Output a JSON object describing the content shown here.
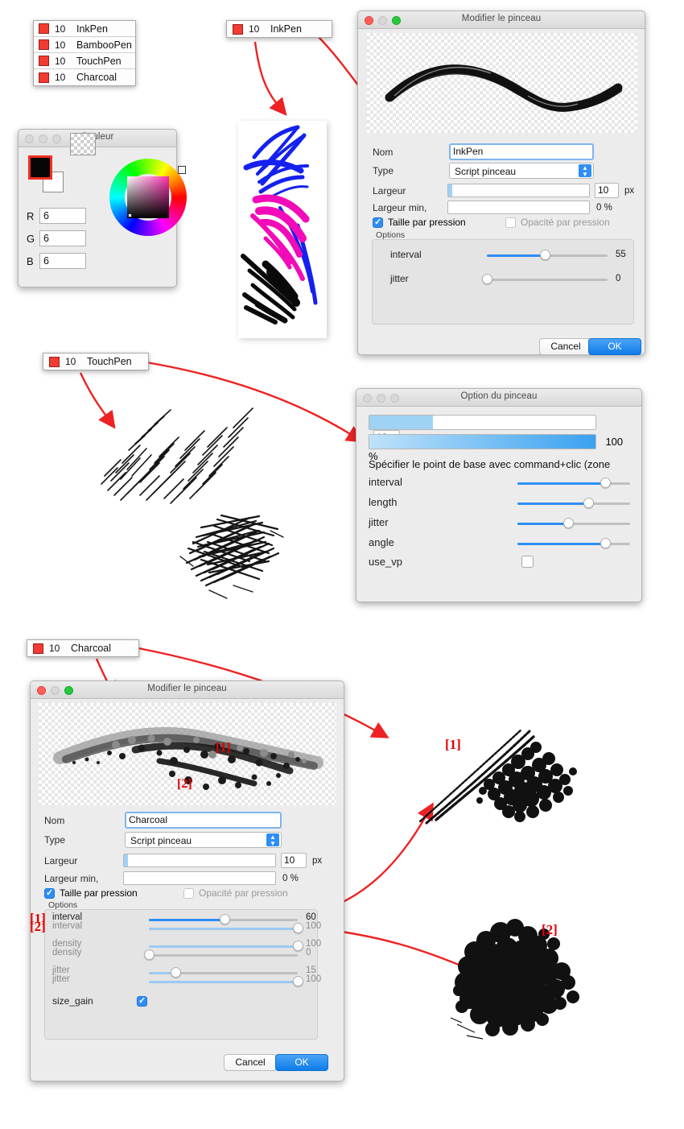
{
  "brush_palette": {
    "items": [
      {
        "size": "10",
        "name": "InkPen"
      },
      {
        "size": "10",
        "name": "BambooPen"
      },
      {
        "size": "10",
        "name": "TouchPen"
      },
      {
        "size": "10",
        "name": "Charcoal"
      }
    ],
    "swatch_color": "#f23b33"
  },
  "tags": {
    "inkpen": {
      "size": "10",
      "name": "InkPen"
    },
    "touchpen": {
      "size": "10",
      "name": "TouchPen"
    },
    "charcoal": {
      "size": "10",
      "name": "Charcoal"
    }
  },
  "color_window": {
    "title": "Couleur",
    "channels": [
      {
        "label": "R",
        "value": "6"
      },
      {
        "label": "G",
        "value": "6"
      },
      {
        "label": "B",
        "value": "6"
      }
    ],
    "foreground_color": "#060606",
    "background_color": "#ffffff"
  },
  "inkpen_dialog": {
    "title": "Modifier le pinceau",
    "fields": {
      "nom_label": "Nom",
      "nom_value": "InkPen",
      "type_label": "Type",
      "type_value": "Script pinceau",
      "largeur_label": "Largeur",
      "largeur_value": "10",
      "largeur_unit": "px",
      "largeur_min_label": "Largeur min,",
      "largeur_min_value": "0 %",
      "taille_pression": "Taille par pression",
      "taille_pression_checked": true,
      "opacite_pression": "Opacité par pression",
      "opacite_pression_checked": false
    },
    "options_label": "Options",
    "sliders": [
      {
        "name": "interval",
        "value": "55",
        "pct": 48
      },
      {
        "name": "jitter",
        "value": "0",
        "pct": 0
      }
    ],
    "buttons": {
      "cancel": "Cancel",
      "ok": "OK"
    }
  },
  "option_dialog": {
    "title": "Option du pinceau",
    "size_value": "10",
    "size_bar_pct": 28,
    "opacity_value": "100 %",
    "opacity_bar_pct": 100,
    "hint": "Spécifier le point de base avec command+clic (zone",
    "sliders": [
      {
        "name": "interval",
        "value": "",
        "pct": 78
      },
      {
        "name": "length",
        "value": "",
        "pct": 63
      },
      {
        "name": "jitter",
        "value": "",
        "pct": 45
      },
      {
        "name": "angle",
        "value": "",
        "pct": 78
      }
    ],
    "checkbox": {
      "label": "use_vp",
      "checked": false
    }
  },
  "charcoal_dialog": {
    "title": "Modifier le pinceau",
    "fields": {
      "nom_label": "Nom",
      "nom_value": "Charcoal",
      "type_label": "Type",
      "type_value": "Script pinceau",
      "largeur_label": "Largeur",
      "largeur_value": "10",
      "largeur_unit": "px",
      "largeur_min_label": "Largeur min,",
      "largeur_min_value": "0 %",
      "taille_pression": "Taille par pression",
      "taille_pression_checked": true,
      "opacite_pression": "Opacité par pression",
      "opacite_pression_checked": false
    },
    "options_label": "Options",
    "marker_1": "[1]",
    "marker_2": "[2]",
    "slider_pairs": [
      {
        "top": {
          "name": "interval",
          "value": "60",
          "pct": 51,
          "dim": false
        },
        "bottom": {
          "name": "interval",
          "value": "100",
          "pct": 100,
          "dim": true
        }
      },
      {
        "top": {
          "name": "density",
          "value": "100",
          "pct": 100,
          "dim": true
        },
        "bottom": {
          "name": "density",
          "value": "0",
          "pct": 0,
          "dim": true
        }
      },
      {
        "top": {
          "name": "jitter",
          "value": "15",
          "pct": 18,
          "dim": true
        },
        "bottom": {
          "name": "jitter",
          "value": "100",
          "pct": 100,
          "dim": true
        }
      }
    ],
    "size_gain": {
      "label": "size_gain",
      "checked": true
    },
    "buttons": {
      "cancel": "Cancel",
      "ok": "OK"
    }
  },
  "annotations": {
    "preview_marker_1": "[1]",
    "preview_marker_2": "[2]",
    "sample_marker_1": "[1]",
    "sample_marker_2": "[2]",
    "arrow_color": "#ee2222"
  }
}
